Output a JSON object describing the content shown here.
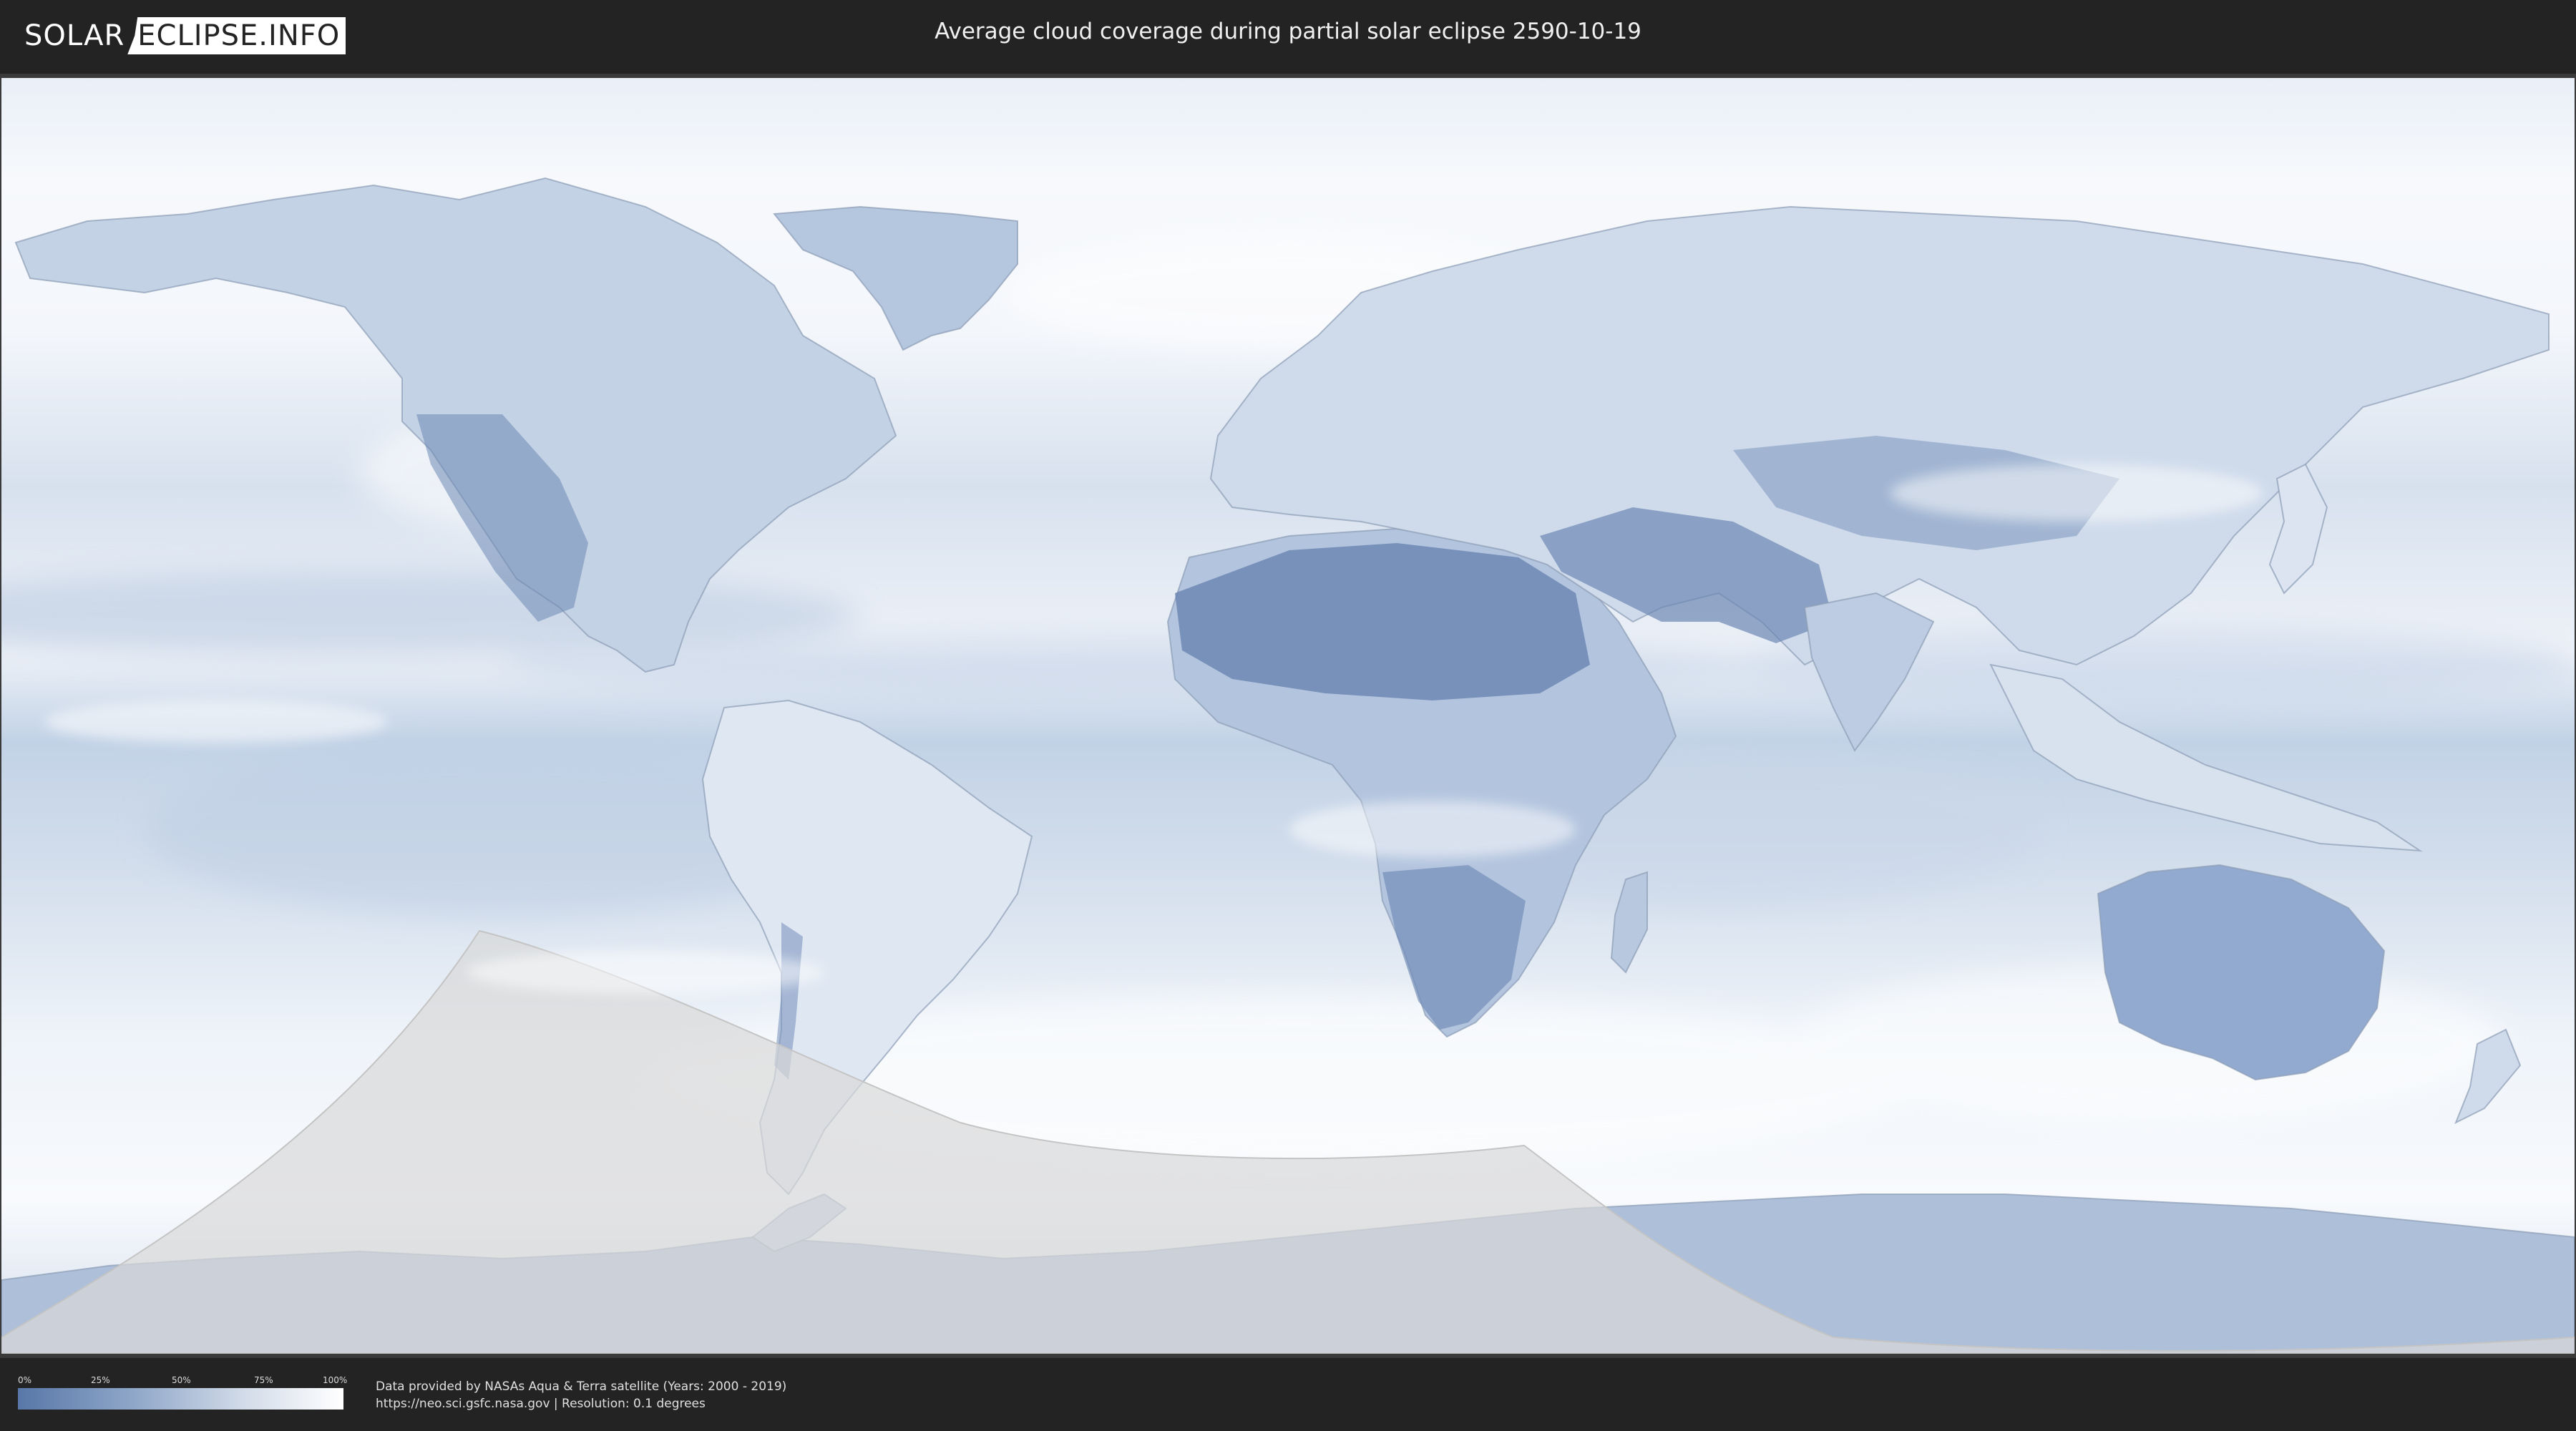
{
  "header": {
    "logo_part1": "SOLAR",
    "logo_part2": "ECLIPSE.INFO",
    "title": "Average cloud coverage during partial solar eclipse 2590-10-19"
  },
  "map": {
    "colors": {
      "clear": "#5877a8",
      "cloudy": "#ffffff",
      "ocean_mid": "#c9d7ea",
      "eclipse_zone": "#d9d9d9"
    }
  },
  "legend": {
    "ticks": [
      "0%",
      "25%",
      "50%",
      "75%",
      "100%"
    ]
  },
  "footer": {
    "source_line": "Data provided by NASAs Aqua & Terra satellite (Years: 2000 - 2019)",
    "url_line": "https://neo.sci.gsfc.nasa.gov | Resolution: 0.1 degrees"
  }
}
